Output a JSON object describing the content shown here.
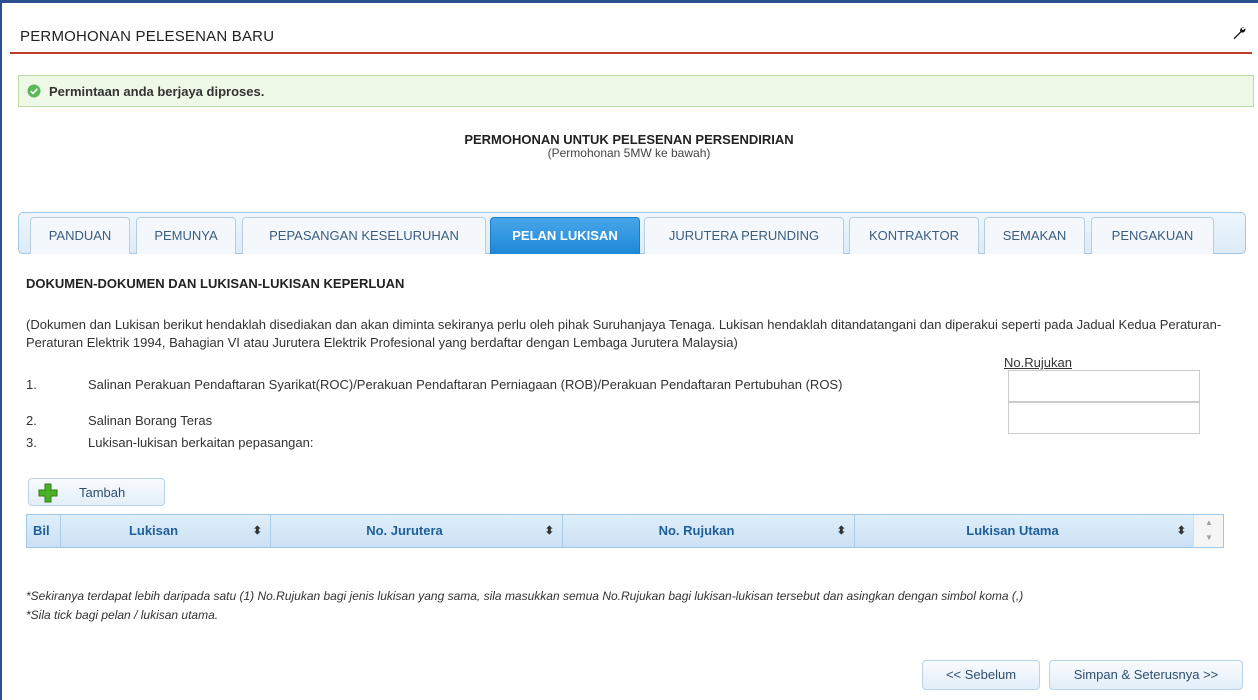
{
  "page": {
    "title": "PERMOHONAN PELESENAN BARU"
  },
  "alert": {
    "message": "Permintaan anda berjaya diproses."
  },
  "form": {
    "title": "PERMOHONAN UNTUK PELESENAN PERSENDIRIAN",
    "subtitle": "(Permohonan 5MW ke bawah)"
  },
  "tabs": [
    {
      "label": "PANDUAN"
    },
    {
      "label": "PEMUNYA"
    },
    {
      "label": "PEPASANGAN KESELURUHAN"
    },
    {
      "label": "PELAN LUKISAN",
      "active": true
    },
    {
      "label": "JURUTERA PERUNDING"
    },
    {
      "label": "KONTRAKTOR"
    },
    {
      "label": "SEMAKAN"
    },
    {
      "label": "PENGAKUAN"
    }
  ],
  "section": {
    "title": "DOKUMEN-DOKUMEN DAN LUKISAN-LUKISAN KEPERLUAN",
    "description": "(Dokumen dan Lukisan berikut hendaklah disediakan dan akan diminta sekiranya perlu oleh pihak Suruhanjaya Tenaga. Lukisan hendaklah ditandatangani dan diperakui seperti pada Jadual Kedua Peraturan-Peraturan Elektrik 1994, Bahagian VI atau Jurutera Elektrik Profesional yang berdaftar dengan Lembaga Jurutera Malaysia)",
    "ref_label": "No.Rujukan"
  },
  "items": [
    {
      "num": "1.",
      "text": "Salinan Perakuan Pendaftaran Syarikat(ROC)/Perakuan Pendaftaran Perniagaan (ROB)/Perakuan Pendaftaran Pertubuhan (ROS)",
      "ref_value": ""
    },
    {
      "num": "2.",
      "text": "Salinan Borang Teras",
      "ref_value": ""
    },
    {
      "num": "3.",
      "text": "Lukisan-lukisan berkaitan pepasangan:"
    }
  ],
  "add_button": {
    "label": "Tambah"
  },
  "grid": {
    "columns": [
      "Bil",
      "Lukisan",
      "No. Jurutera",
      "No. Rujukan",
      "Lukisan Utama"
    ],
    "sort_icon": "⬍"
  },
  "notes": [
    "*Sekiranya terdapat lebih daripada satu (1) No.Rujukan bagi jenis lukisan yang sama, sila masukkan semua No.Rujukan bagi lukisan-lukisan tersebut dan asingkan dengan simbol koma (,)",
    "*Sila tick bagi pelan / lukisan utama."
  ],
  "nav": {
    "prev_label": "<< Sebelum",
    "next_label": "Simpan & Seterusnya >>"
  },
  "colors": {
    "accent": "#1e88d7",
    "header_rule": "#c0392b",
    "success_bg": "#eef8e6"
  },
  "icons": {
    "header": "wrench-icon",
    "alert": "check-circle-icon",
    "add": "plus-icon"
  }
}
